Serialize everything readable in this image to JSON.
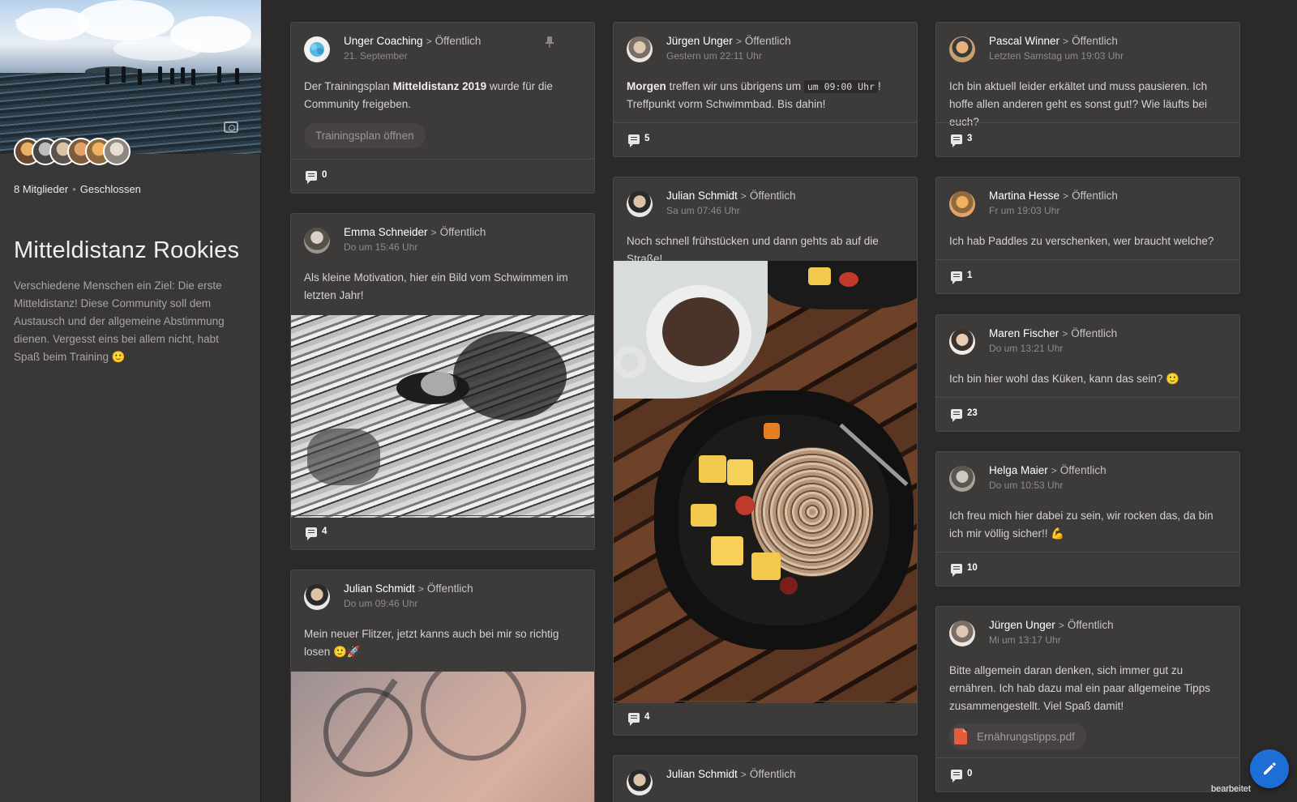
{
  "group": {
    "members_text": "8 Mitglieder",
    "privacy_text": "Geschlossen",
    "title": "Mitteldistanz Rookies",
    "description": "Verschiedene Menschen ein Ziel: Die erste Mitteldistanz! Diese Community soll dem Austausch und der allgemeine Abstimmung dienen. Vergesst eins bei allem nicht, habt Spaß beim Training 🙂",
    "icons": {
      "back": "arrow-left-icon",
      "camera": "camera-icon"
    }
  },
  "posts": [
    {
      "author": "Unger Coaching",
      "visibility": "Öffentlich",
      "time": "21. September",
      "text_before": "Der Trainingsplan ",
      "text_bold": "Mitteldistanz 2019",
      "text_after": " wurde für die Community freigeben.",
      "button": "Trainingsplan öffnen",
      "comments": "0"
    },
    {
      "author": "Emma Schneider",
      "visibility": "Öffentlich",
      "time": "Do um 15:46 Uhr",
      "text": "Als kleine Motivation, hier ein Bild vom Schwimmen im letzten Jahr!",
      "comments": "4"
    },
    {
      "author": "Julian Schmidt",
      "visibility": "Öffentlich",
      "time": "Do um 09:46 Uhr",
      "text": "Mein neuer Flitzer, jetzt kanns auch bei mir so richtig losen 🙂🚀"
    },
    {
      "author": "Jürgen Unger",
      "visibility": "Öffentlich",
      "time": "Gestern um 22:11 Uhr",
      "text_bold": "Morgen",
      "text_mid": " treffen wir uns übrigens um ",
      "text_code": "um 09:00 Uhr",
      "text_after": "! Treffpunkt vorm Schwimmbad. Bis dahin!",
      "comments": "5"
    },
    {
      "author": "Julian Schmidt",
      "visibility": "Öffentlich",
      "time": "Sa um 07:46 Uhr",
      "text": "Noch schnell frühstücken und dann gehts ab auf die Straße!",
      "comments": "4"
    },
    {
      "author": "Julian Schmidt",
      "visibility": "Öffentlich"
    },
    {
      "author": "Pascal Winner",
      "visibility": "Öffentlich",
      "time": "Letzten Samstag um 19:03 Uhr",
      "text": "Ich bin aktuell leider erkältet und muss pausieren. Ich hoffe allen anderen geht es sonst gut!? Wie läufts bei euch?",
      "comments": "3"
    },
    {
      "author": "Martina Hesse",
      "visibility": "Öffentlich",
      "time": "Fr um 19:03 Uhr",
      "text": "Ich hab Paddles zu verschenken, wer braucht welche?",
      "comments": "1"
    },
    {
      "author": "Maren Fischer",
      "visibility": "Öffentlich",
      "time": "Do um 13:21 Uhr",
      "text": "Ich bin hier wohl das Küken, kann das sein? 🙂",
      "comments": "23"
    },
    {
      "author": "Helga Maier",
      "visibility": "Öffentlich",
      "time": "Do um 10:53 Uhr",
      "text": "Ich freu mich hier dabei zu sein, wir rocken das, da bin ich mir völlig sicher!! 💪",
      "comments": "10"
    },
    {
      "author": "Jürgen Unger",
      "visibility": "Öffentlich",
      "time": "Mi um 13:17 Uhr",
      "text": "Bitte allgemein daran denken, sich immer gut zu ernähren. Ich hab dazu mal ein paar allgemeine Tipps zusammengestellt. Viel Spaß damit!",
      "attachment": "Ernährungstipps.pdf",
      "comments": "0"
    }
  ],
  "fab": {
    "icon": "pencil-icon",
    "status": "bearbeitet"
  },
  "colors": {
    "background": "#2b2929",
    "card": "#3d3a3a",
    "sidebar": "#3a3737",
    "accent": "#1d6fd6"
  }
}
